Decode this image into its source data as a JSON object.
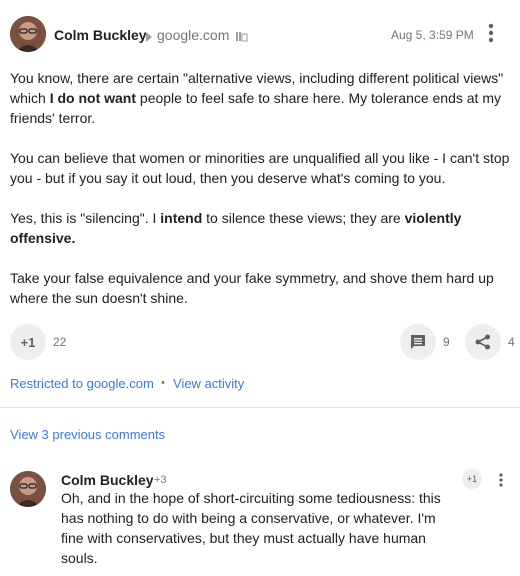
{
  "post": {
    "author": "Colm Buckley",
    "community": "google.com",
    "timestamp": "Aug 5, 3:59 PM",
    "paragraphs": {
      "p1_a": "You know, there are certain \"alternative views, including different political views\" which ",
      "p1_b": "I do not want",
      "p1_c": " people to feel safe to share here. My tolerance ends at my friends' terror.",
      "p2": "You can believe that women or minorities are unqualified all you like - I can't stop you - but if you say it out loud, then you deserve what's coming to you.",
      "p3_a": "Yes, this is \"silencing\". I ",
      "p3_b": "intend",
      "p3_c": " to silence these views; they are ",
      "p3_d": "violently offensive.",
      "p4": "Take your false equivalence and your fake symmetry, and shove them hard up where the sun doesn't shine."
    },
    "plus_one_label": "+1",
    "plus_one_count": "22",
    "comment_count": "9",
    "share_count": "4",
    "restricted_label": "Restricted to google.com",
    "separator": "•",
    "view_activity_label": "View activity"
  },
  "comments": {
    "view_previous_label": "View 3 previous comments",
    "items": [
      {
        "author": "Colm Buckley",
        "plus_count": "+3",
        "plus_one_label": "+1",
        "text": "Oh, and in the hope of short-circuiting some tediousness: this has nothing to do with being a conservative, or whatever. I'm fine with conservatives, but they must actually have human souls."
      }
    ]
  },
  "icons": {
    "more": "more-vert-icon",
    "arrow": "arrow-right-icon",
    "community": "community-icon",
    "comment": "comment-icon",
    "share": "share-icon"
  }
}
